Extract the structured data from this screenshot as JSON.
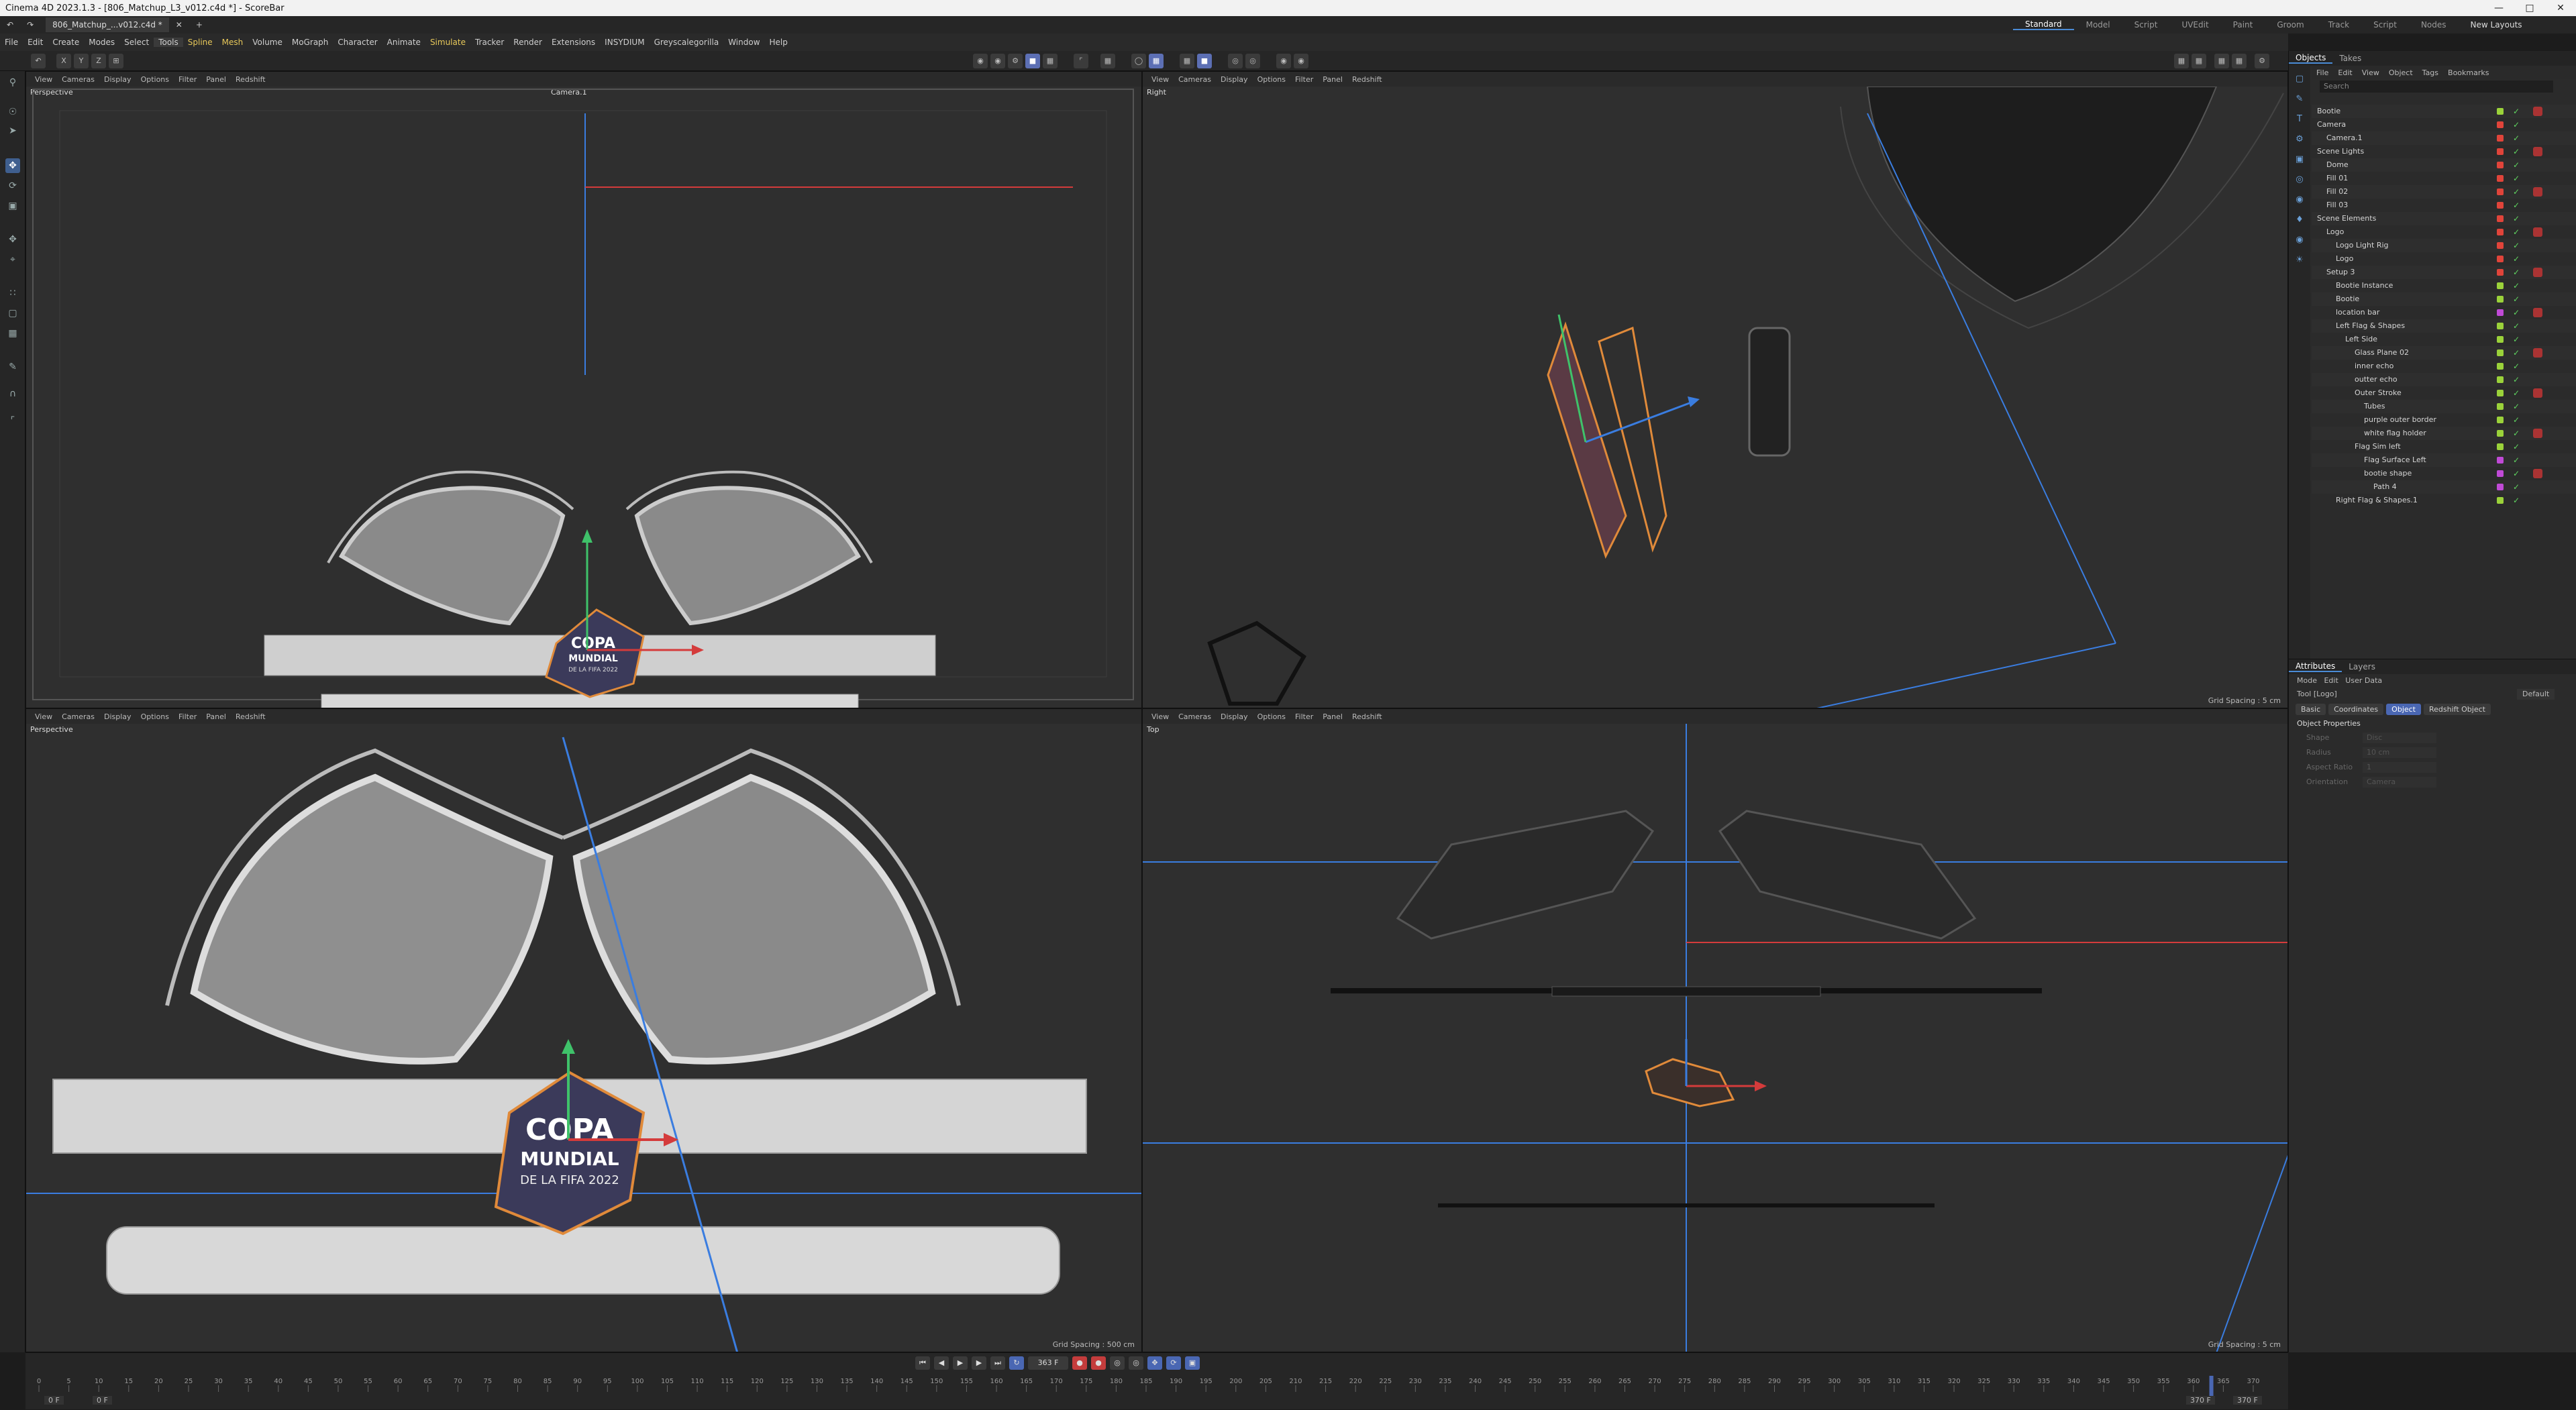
{
  "window": {
    "title": "Cinema 4D 2023.1.3 - [806_Matchup_L3_v012.c4d *] - ScoreBar"
  },
  "tabs": {
    "doc": "806_Matchup_...v012.c4d *",
    "plus": "+"
  },
  "menubar": [
    "File",
    "Edit",
    "Create",
    "Modes",
    "Select",
    "Tools",
    "Spline",
    "Mesh",
    "Volume",
    "MoGraph",
    "Character",
    "Animate",
    "Simulate",
    "Tracker",
    "Render",
    "Extensions",
    "INSYDIUM",
    "Greyscalegorilla",
    "Window",
    "Help"
  ],
  "layouts": [
    "Standard",
    "Model",
    "Script",
    "UVEdit",
    "Paint",
    "Groom",
    "Track",
    "Script",
    "Nodes"
  ],
  "new_layouts": "New Layouts",
  "viewports": {
    "menu": [
      "View",
      "Cameras",
      "Display",
      "Options",
      "Filter",
      "Panel",
      "Redshift"
    ],
    "tl": {
      "label": "Perspective",
      "camera": "Camera.1"
    },
    "tr": {
      "label": "Right",
      "grid": "Grid Spacing : 5 cm"
    },
    "bl": {
      "label": "Perspective",
      "grid": "Grid Spacing : 500 cm"
    },
    "br": {
      "label": "Top",
      "grid": "Grid Spacing : 5 cm"
    }
  },
  "logo": {
    "line1": "COPA",
    "line2": "MUNDIAL",
    "line3": "DE LA FIFA 2022"
  },
  "manager": {
    "tabs": [
      "Objects",
      "Takes"
    ],
    "menu": [
      "File",
      "Edit",
      "View",
      "Object",
      "Tags",
      "Bookmarks"
    ],
    "search": "Search",
    "objects": [
      {
        "name": "Bootie",
        "indent": 0,
        "color": "#9bd23a"
      },
      {
        "name": "Camera",
        "indent": 0,
        "color": "#e0443a"
      },
      {
        "name": "Camera.1",
        "indent": 1,
        "color": "#e0443a"
      },
      {
        "name": "Scene Lights",
        "indent": 0,
        "color": "#e0443a"
      },
      {
        "name": "Dome",
        "indent": 1,
        "color": "#e0443a"
      },
      {
        "name": "Fill 01",
        "indent": 1,
        "color": "#e0443a"
      },
      {
        "name": "Fill 02",
        "indent": 1,
        "color": "#e0443a"
      },
      {
        "name": "Fill 03",
        "indent": 1,
        "color": "#e0443a"
      },
      {
        "name": "Scene Elements",
        "indent": 0,
        "color": "#e0443a"
      },
      {
        "name": "Logo",
        "indent": 1,
        "color": "#e0443a"
      },
      {
        "name": "Logo Light Rig",
        "indent": 2,
        "color": "#e0443a"
      },
      {
        "name": "Logo",
        "indent": 2,
        "color": "#e0443a"
      },
      {
        "name": "Setup 3",
        "indent": 1,
        "color": "#e0443a"
      },
      {
        "name": "Bootie Instance",
        "indent": 2,
        "color": "#9bd23a"
      },
      {
        "name": "Bootie",
        "indent": 2,
        "color": "#9bd23a"
      },
      {
        "name": "location bar",
        "indent": 2,
        "color": "#c04ad6"
      },
      {
        "name": "Left Flag & Shapes",
        "indent": 2,
        "color": "#9bd23a"
      },
      {
        "name": "Left Side",
        "indent": 3,
        "color": "#9bd23a"
      },
      {
        "name": "Glass Plane 02",
        "indent": 4,
        "color": "#9bd23a"
      },
      {
        "name": "inner echo",
        "indent": 4,
        "color": "#9bd23a"
      },
      {
        "name": "outter echo",
        "indent": 4,
        "color": "#9bd23a"
      },
      {
        "name": "Outer Stroke",
        "indent": 4,
        "color": "#9bd23a"
      },
      {
        "name": "Tubes",
        "indent": 5,
        "color": "#9bd23a"
      },
      {
        "name": "purple outer border",
        "indent": 5,
        "color": "#9bd23a"
      },
      {
        "name": "white flag holder",
        "indent": 5,
        "color": "#9bd23a"
      },
      {
        "name": "Flag Sim left",
        "indent": 4,
        "color": "#9bd23a"
      },
      {
        "name": "Flag Surface Left",
        "indent": 5,
        "color": "#c04ad6"
      },
      {
        "name": "bootie shape",
        "indent": 5,
        "color": "#c04ad6"
      },
      {
        "name": "Path 4",
        "indent": 6,
        "color": "#c04ad6"
      },
      {
        "name": "Right Flag & Shapes.1",
        "indent": 2,
        "color": "#9bd23a"
      }
    ]
  },
  "attributes": {
    "tabs": [
      "Attributes",
      "Layers"
    ],
    "menu": [
      "Mode",
      "Edit",
      "User Data"
    ],
    "object": "Tool [Logo]",
    "preset": "Default",
    "buttons": [
      "Basic",
      "Coordinates",
      "Object",
      "Redshift Object"
    ],
    "section": "Object Properties",
    "props": [
      {
        "label": "Shape",
        "value": "Disc"
      },
      {
        "label": "Radius",
        "value": "10 cm"
      },
      {
        "label": "Aspect Ratio",
        "value": "1"
      },
      {
        "label": "Orientation",
        "value": "Camera"
      }
    ]
  },
  "timeline": {
    "current_frame": "363 F",
    "start": "0 F",
    "end_a": "370 F",
    "end_b": "370 F",
    "field2": "0 F",
    "ticks": [
      "0",
      "5",
      "10",
      "15",
      "20",
      "25",
      "30",
      "35",
      "40",
      "45",
      "50",
      "55",
      "60",
      "65",
      "70",
      "75",
      "80",
      "85",
      "90",
      "95",
      "100",
      "105",
      "110",
      "115",
      "120",
      "125",
      "130",
      "135",
      "140",
      "145",
      "150",
      "155",
      "160",
      "165",
      "170",
      "175",
      "180",
      "185",
      "190",
      "195",
      "200",
      "205",
      "210",
      "215",
      "220",
      "225",
      "230",
      "235",
      "240",
      "245",
      "250",
      "255",
      "260",
      "265",
      "270",
      "275",
      "280",
      "285",
      "290",
      "295",
      "300",
      "305",
      "310",
      "315",
      "320",
      "325",
      "330",
      "335",
      "340",
      "345",
      "350",
      "355",
      "360",
      "365",
      "370"
    ]
  },
  "colors": {
    "accent": "#4a67b3",
    "selection": "#e08a3a",
    "axis_x": "#d43b3b",
    "axis_y": "#3fc26a",
    "axis_z": "#3a7de0"
  }
}
